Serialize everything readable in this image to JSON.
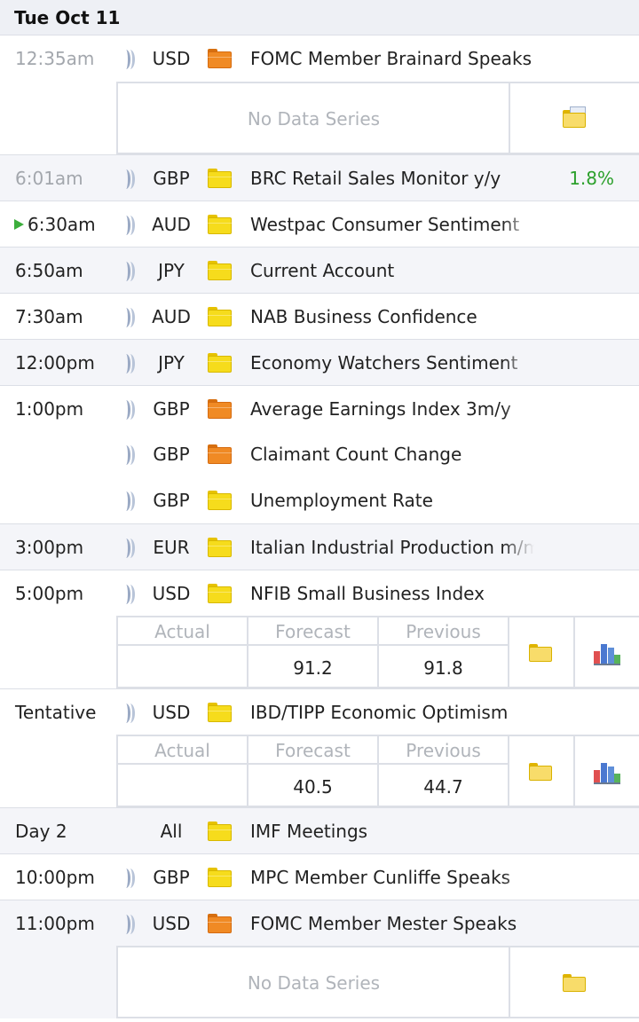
{
  "day": "Tue Oct 11",
  "events": [
    {
      "time": "12:35am",
      "currency": "USD",
      "importance": "orange",
      "title": "FOMC Member Brainard Speaks",
      "past": true,
      "panel": "nodata"
    },
    {
      "time": "6:01am",
      "currency": "GBP",
      "importance": "yellow",
      "title": "BRC Retail Sales Monitor y/y",
      "past": true,
      "actual": "1.8%"
    },
    {
      "time": "6:30am",
      "currency": "AUD",
      "importance": "yellow",
      "title": "Westpac Consumer Sentiment",
      "now": true
    },
    {
      "time": "6:50am",
      "currency": "JPY",
      "importance": "yellow",
      "title": "Current Account"
    },
    {
      "time": "7:30am",
      "currency": "AUD",
      "importance": "yellow",
      "title": "NAB Business Confidence"
    },
    {
      "time": "12:00pm",
      "currency": "JPY",
      "importance": "yellow",
      "title": "Economy Watchers Sentiment"
    },
    {
      "time": "1:00pm",
      "currency": "GBP",
      "importance": "orange",
      "title": "Average Earnings Index 3m/y"
    },
    {
      "time": "",
      "currency": "GBP",
      "importance": "orange",
      "title": "Claimant Count Change"
    },
    {
      "time": "",
      "currency": "GBP",
      "importance": "yellow",
      "title": "Unemployment Rate"
    },
    {
      "time": "3:00pm",
      "currency": "EUR",
      "importance": "yellow",
      "title": "Italian Industrial Production m/m"
    },
    {
      "time": "5:00pm",
      "currency": "USD",
      "importance": "yellow",
      "title": "NFIB Small Business Index",
      "panel": "data",
      "forecast": "91.2",
      "previous": "91.8"
    },
    {
      "time": "Tentative",
      "currency": "USD",
      "importance": "yellow",
      "title": "IBD/TIPP Economic Optimism",
      "panel": "data",
      "forecast": "40.5",
      "previous": "44.7"
    },
    {
      "time": "Day 2",
      "currency": "All",
      "importance": "yellow",
      "title": "IMF Meetings"
    },
    {
      "time": "10:00pm",
      "currency": "GBP",
      "importance": "yellow",
      "title": "MPC Member Cunliffe Speaks"
    },
    {
      "time": "11:00pm",
      "currency": "USD",
      "importance": "orange",
      "title": "FOMC Member Mester Speaks",
      "panel": "nodata"
    }
  ],
  "labels": {
    "no_data": "No Data Series",
    "actual": "Actual",
    "forecast": "Forecast",
    "previous": "Previous"
  },
  "colors": {
    "positive": "#2ca02c",
    "importance_yellow": "#f6dc1c",
    "importance_orange": "#f08a24",
    "now_marker": "#3cae3c"
  }
}
